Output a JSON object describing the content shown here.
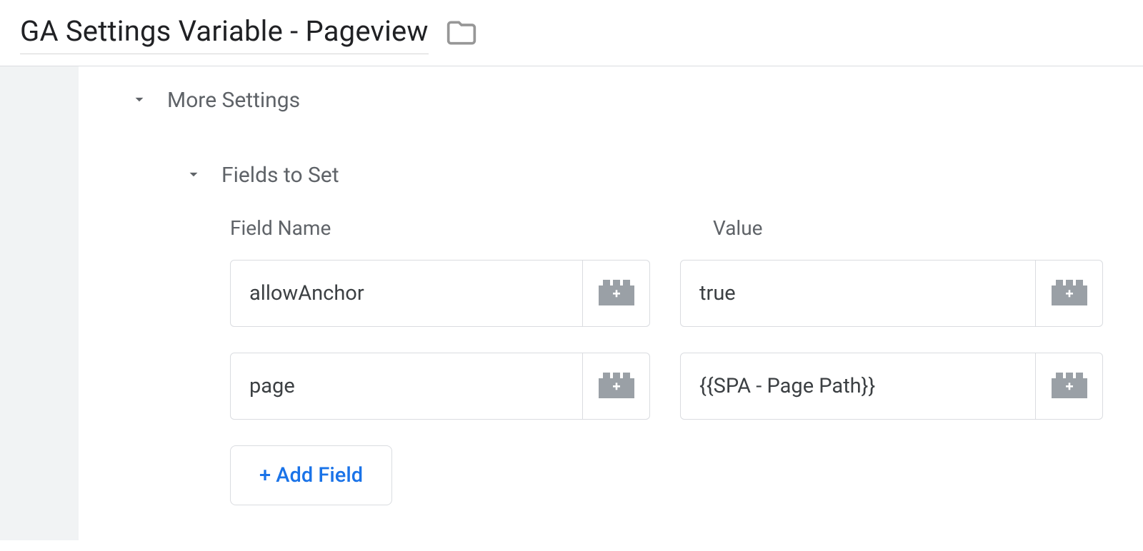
{
  "header": {
    "title": "GA Settings Variable - Pageview"
  },
  "sections": {
    "moreSettings": {
      "label": "More Settings"
    },
    "fieldsToSet": {
      "label": "Fields to Set",
      "columns": {
        "name": "Field Name",
        "value": "Value"
      },
      "rows": [
        {
          "name": "allowAnchor",
          "value": "true"
        },
        {
          "name": "page",
          "value": "{{SPA - Page Path}}"
        }
      ],
      "addButton": "+ Add Field"
    }
  }
}
